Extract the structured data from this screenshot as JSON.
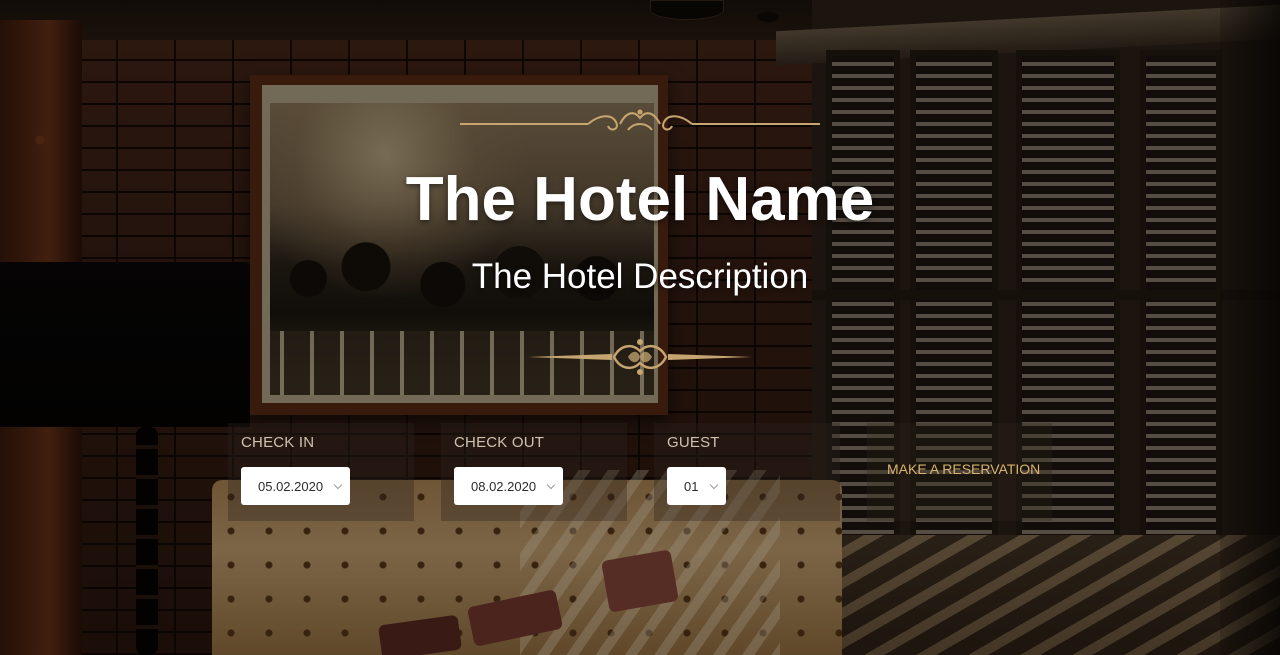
{
  "hero": {
    "title": "The Hotel Name",
    "subtitle": "The Hotel Description",
    "ornaments": [
      "ornament-divider-top",
      "ornament-divider-bottom"
    ]
  },
  "booking": {
    "check_in": {
      "label": "CHECK IN",
      "value": "05.02.2020"
    },
    "check_out": {
      "label": "CHECK OUT",
      "value": "08.02.2020"
    },
    "guest": {
      "label": "GUEST",
      "value": "01"
    },
    "reserve_label": "MAKE A RESERVATION"
  },
  "colors": {
    "accent_gold": "#d8b46f",
    "label_text": "#cfc3b0",
    "title_text": "#ffffff",
    "panel_bg": "#2d231c"
  },
  "icons": {
    "select_chevron": "chevron-down-icon"
  }
}
